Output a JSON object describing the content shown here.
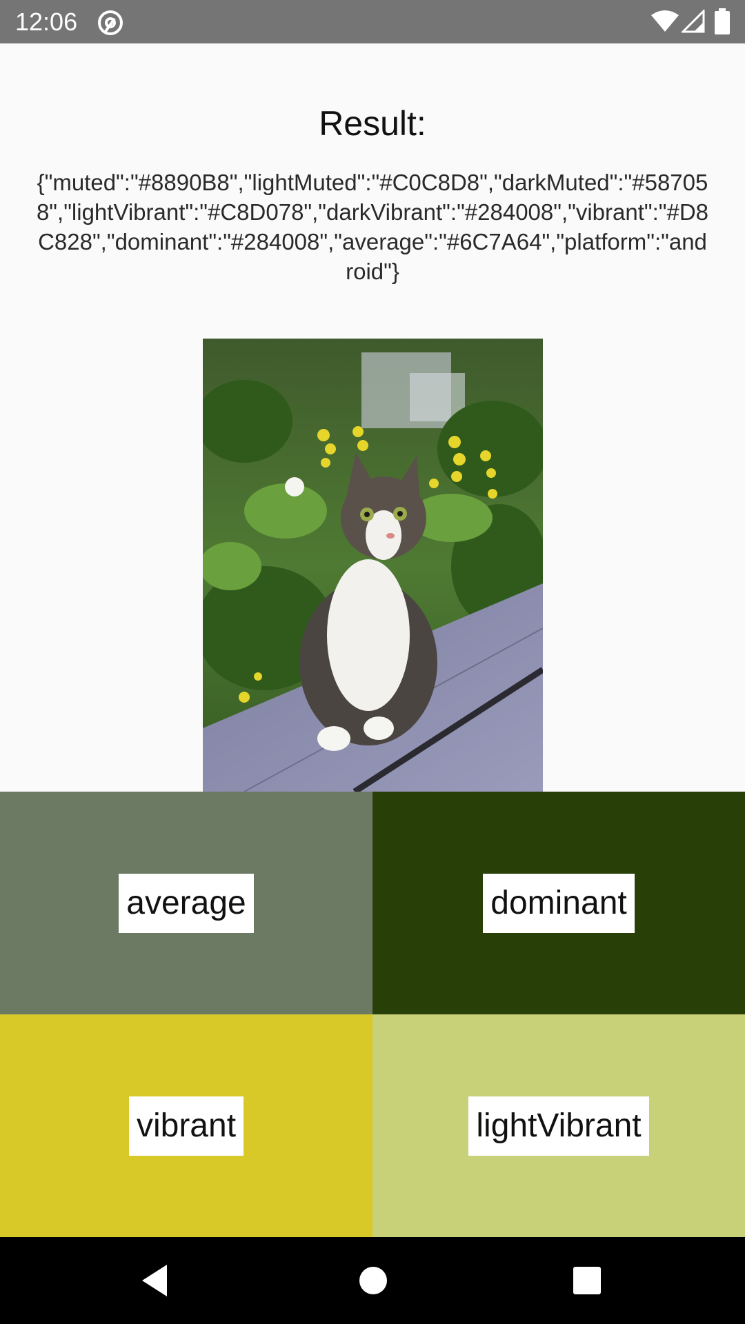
{
  "status_bar": {
    "time": "12:06",
    "icons": [
      "at-sign-icon",
      "wifi-icon",
      "signal-icon",
      "battery-icon"
    ]
  },
  "result": {
    "title": "Result:",
    "json_text": "{\"muted\":\"#8890B8\",\"lightMuted\":\"#C0C8D8\",\"darkMuted\":\"#587058\",\"lightVibrant\":\"#C8D078\",\"darkVibrant\":\"#284008\",\"vibrant\":\"#D8C828\",\"dominant\":\"#284008\",\"average\":\"#6C7A64\",\"platform\":\"android\"}"
  },
  "image": {
    "subject": "cat photo"
  },
  "swatches": [
    {
      "label": "average",
      "color": "#6C7A64"
    },
    {
      "label": "dominant",
      "color": "#284008"
    },
    {
      "label": "vibrant",
      "color": "#D8C828"
    },
    {
      "label": "lightVibrant",
      "color": "#C8D078"
    }
  ],
  "nav_bar": {
    "buttons": [
      "back-icon",
      "home-icon",
      "recents-icon"
    ]
  }
}
